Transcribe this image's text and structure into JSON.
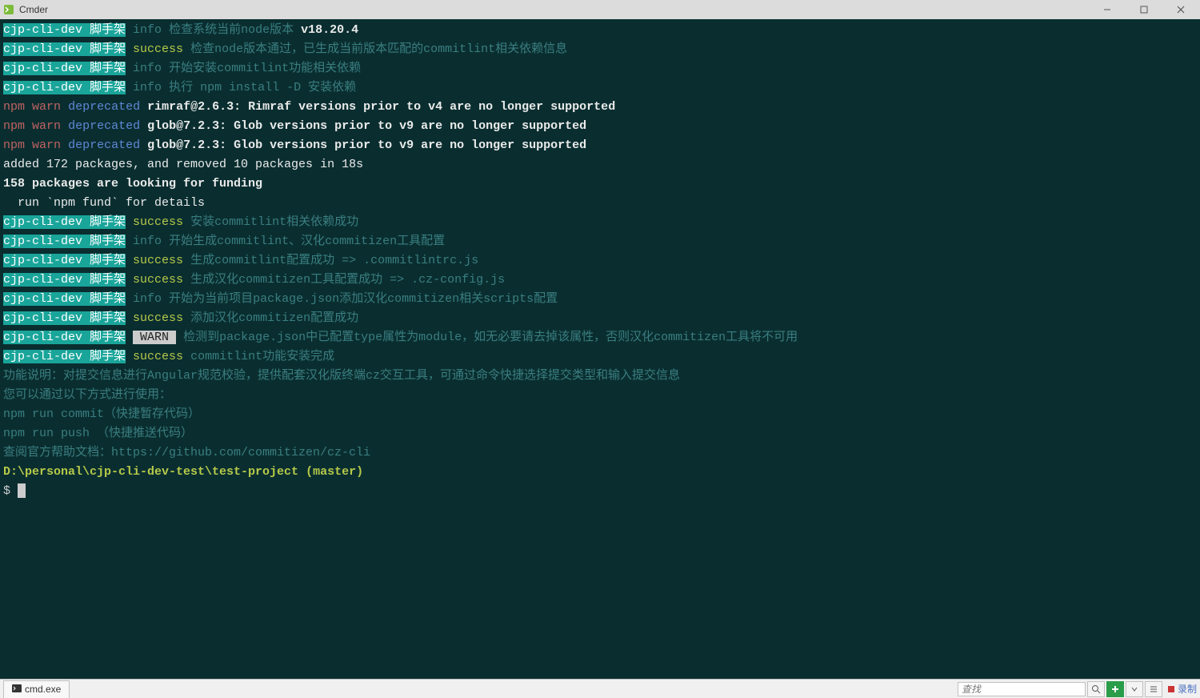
{
  "window": {
    "title": "Cmder"
  },
  "lines": [
    {
      "prefix": "cjp-cli-dev 脚手架",
      "level": "info",
      "levelClass": "cyan-dark",
      "msg": "检查系统当前node版本",
      "extra": "v18.20.4",
      "extraClass": "white bold"
    },
    {
      "prefix": "cjp-cli-dev 脚手架",
      "level": "success",
      "levelClass": "green",
      "msg": "检查node版本通过，已生成当前版本匹配的commitlint相关依赖信息"
    },
    {
      "prefix": "cjp-cli-dev 脚手架",
      "level": "info",
      "levelClass": "cyan-dark",
      "msg": "开始安装commitlint功能相关依赖"
    },
    {
      "prefix": "cjp-cli-dev 脚手架",
      "level": "info",
      "levelClass": "cyan-dark",
      "msg": "执行 npm install -D 安装依赖"
    }
  ],
  "npmwarn": [
    {
      "pkg": "rimraf@2.6.3:",
      "msg": "Rimraf versions prior to v4 are no longer supported"
    },
    {
      "pkg": "glob@7.2.3:",
      "msg": "Glob versions prior to v9 are no longer supported"
    },
    {
      "pkg": "glob@7.2.3:",
      "msg": "Glob versions prior to v9 are no longer supported"
    }
  ],
  "plain": {
    "added": "added 172 packages, and removed 10 packages in 18s",
    "funding1": "158 packages are looking for funding",
    "funding2": "  run `npm fund` for details"
  },
  "lines2": [
    {
      "prefix": "cjp-cli-dev 脚手架",
      "level": "success",
      "levelClass": "green",
      "msg": "安装commitlint相关依赖成功"
    },
    {
      "prefix": "cjp-cli-dev 脚手架",
      "level": "info",
      "levelClass": "cyan-dark",
      "msg": "开始生成commitlint、汉化commitizen工具配置"
    },
    {
      "prefix": "cjp-cli-dev 脚手架",
      "level": "success",
      "levelClass": "green",
      "msg": "生成commitlint配置成功 => .commitlintrc.js"
    },
    {
      "prefix": "cjp-cli-dev 脚手架",
      "level": "success",
      "levelClass": "green",
      "msg": "生成汉化commitizen工具配置成功 => .cz-config.js"
    },
    {
      "prefix": "cjp-cli-dev 脚手架",
      "level": "info",
      "levelClass": "cyan-dark",
      "msg": "开始为当前项目package.json添加汉化commitizen相关scripts配置"
    },
    {
      "prefix": "cjp-cli-dev 脚手架",
      "level": "success",
      "levelClass": "green",
      "msg": "添加汉化commitizen配置成功"
    },
    {
      "prefix": "cjp-cli-dev 脚手架",
      "level": "WARN",
      "levelClass": "warn-badge",
      "msg": "检测到package.json中已配置type属性为module，如无必要请去掉该属性，否则汉化commitizen工具将不可用"
    },
    {
      "prefix": "cjp-cli-dev 脚手架",
      "level": "success",
      "levelClass": "green",
      "msg": "commitlint功能安装完成"
    }
  ],
  "help": {
    "desc": "功能说明：对提交信息进行Angular规范校验，提供配套汉化版终端cz交互工具，可通过命令快捷选择提交类型和输入提交信息",
    "usage_intro": "您可以通过以下方式进行使用：",
    "cmd1": "npm run commit（快捷暂存代码）",
    "cmd2": "npm run push （快捷推送代码）",
    "doc": "查阅官方帮助文档：https://github.com/commitizen/cz-cli"
  },
  "prompt": {
    "path": "D:\\personal\\cjp-cli-dev-test\\test-project",
    "branch": "(master)",
    "symbol": "$"
  },
  "tabbar": {
    "tab_label": "cmd.exe",
    "search_placeholder": "查找",
    "end_label": "录制"
  },
  "npm_labels": {
    "npm": "npm",
    "warn": "warn",
    "deprecated": "deprecated"
  }
}
